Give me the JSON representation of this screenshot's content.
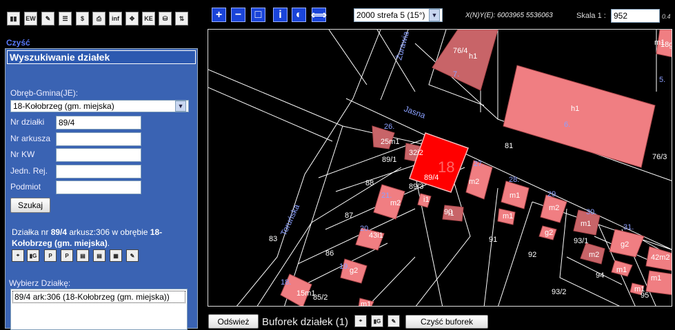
{
  "toolbar": {
    "icons": [
      {
        "name": "toolbar-chart-icon",
        "glyph": "▮▮"
      },
      {
        "name": "toolbar-layer-icon",
        "glyph": "EW"
      },
      {
        "name": "toolbar-measure-icon",
        "glyph": "✎"
      },
      {
        "name": "toolbar-list-icon",
        "glyph": "☰"
      },
      {
        "name": "toolbar-dollar-icon",
        "glyph": "$"
      },
      {
        "name": "toolbar-print-icon",
        "glyph": "⎙"
      },
      {
        "name": "toolbar-info-icon",
        "glyph": "inf"
      },
      {
        "name": "toolbar-extent-icon",
        "glyph": "✥"
      },
      {
        "name": "toolbar-kerg-icon",
        "glyph": "KE"
      },
      {
        "name": "toolbar-database-icon",
        "glyph": "⛁"
      },
      {
        "name": "toolbar-arrows-icon",
        "glyph": "⇅"
      }
    ]
  },
  "left_panel": {
    "clear_link": "Czyść",
    "title": "Wyszukiwanie działek",
    "obreb_label": "Obręb-Gmina(JE):",
    "obreb_value": "18-Kołobrzeg (gm. miejska)",
    "fields": [
      {
        "label": "Nr działki",
        "value": "89/4"
      },
      {
        "label": "Nr arkusza",
        "value": ""
      },
      {
        "label": "Nr KW",
        "value": ""
      },
      {
        "label": "Jedn. Rej.",
        "value": ""
      },
      {
        "label": "Podmiot",
        "value": ""
      }
    ],
    "search_button": "Szukaj",
    "result": {
      "prefix": "Działka nr ",
      "parcel": "89/4",
      "middle": " arkusz:306 w obrębie ",
      "area": "18-Kołobrzeg (gm. miejska)",
      "suffix": "."
    },
    "choose_label": "Wybierz Działkę:",
    "list_items": [
      "89/4 ark:306 (18-Kołobrzeg (gm. miejska))"
    ]
  },
  "map_header": {
    "buttons": [
      {
        "name": "zoom-in-button",
        "glyph": "+"
      },
      {
        "name": "zoom-out-button",
        "glyph": "−"
      },
      {
        "name": "zoom-extent-button",
        "glyph": "□"
      },
      {
        "name": "info-button",
        "glyph": "i"
      },
      {
        "name": "layers-button",
        "glyph": "◐"
      },
      {
        "name": "pan-button",
        "glyph": "⟺"
      }
    ],
    "crs_select": "2000 strefa 5 (15°)",
    "coords_text": "X(N)Y(E): 6003965 5536063",
    "scale_label": "Skala 1 :",
    "scale_value": "952",
    "scale_extra": "0.4"
  },
  "map": {
    "streets": [
      "Jasna",
      "Żurawia",
      "Toruńska"
    ],
    "selected_parcel": {
      "number": "89/4",
      "area_number": "18"
    },
    "parcel_labels": [
      "76/4",
      "81",
      "76/3",
      "89/1",
      "88",
      "89/3",
      "87",
      "90",
      "83",
      "86",
      "91",
      "92",
      "93/1",
      "94",
      "93/2",
      "95",
      "85/2"
    ],
    "building_labels": [
      "h1",
      "h1",
      "25m1",
      "32i2",
      "m2",
      "m2",
      "i1",
      "i1",
      "m1",
      "m1",
      "m2",
      "g2",
      "m1",
      "g2",
      "m2",
      "m1",
      "42m2",
      "m1",
      "m1",
      "43i1",
      "g2",
      "15m1",
      "18g1",
      "m1",
      "m1",
      "m2",
      "g1",
      "i1",
      "g1",
      "i1",
      "i1"
    ],
    "address_numbers": [
      "7.",
      "6.",
      "5.",
      "26.",
      "27.",
      "28.",
      "29.",
      "30.",
      "31.",
      "21.",
      "20.",
      "19.",
      "18."
    ]
  },
  "bottom_bar": {
    "refresh_button": "Odśwież",
    "buffer_label": "Buforek działek (1)",
    "clear_buffer_button": "Czyść buforek"
  }
}
